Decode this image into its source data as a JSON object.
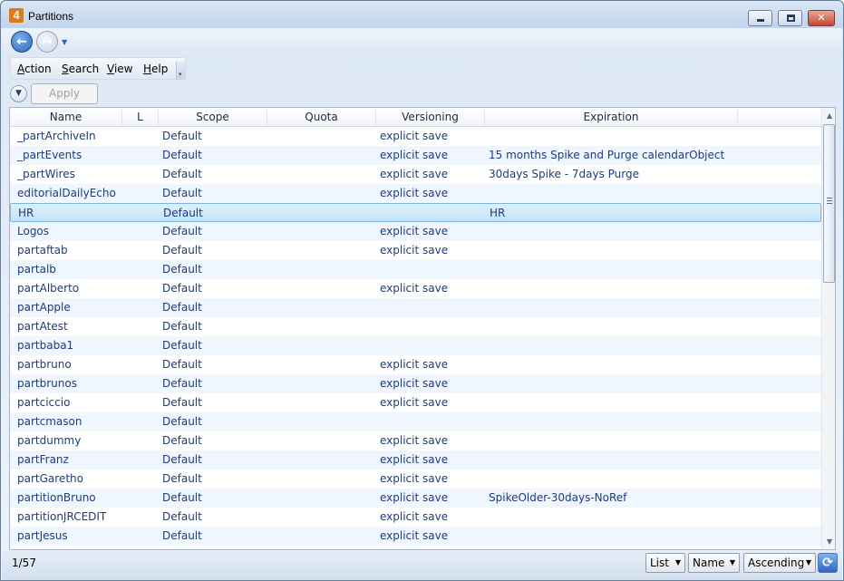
{
  "window": {
    "title": "Partitions",
    "app_icon": "4"
  },
  "nav": {
    "back_icon": "back-arrow-icon",
    "forward_icon": "forward-arrow-icon"
  },
  "menu": {
    "items": [
      {
        "label": "Action",
        "icon": ""
      },
      {
        "label": "Search",
        "icon": ""
      },
      {
        "label": "View",
        "icon": ""
      },
      {
        "label": "Help",
        "icon": ""
      }
    ]
  },
  "search": {
    "apply_label": "Apply Search"
  },
  "table": {
    "columns": [
      "Name",
      "L",
      "Scope",
      "Quota",
      "Versioning",
      "Expiration"
    ],
    "rows": [
      {
        "name": "_partArchiveIn",
        "scope": "Default",
        "versioning": "explicit save",
        "expiration": ""
      },
      {
        "name": "_partEvents",
        "scope": "Default",
        "versioning": "explicit save",
        "expiration": "15 months Spike and Purge calendarObject"
      },
      {
        "name": "_partWires",
        "scope": "Default",
        "versioning": "explicit save",
        "expiration": "30days Spike - 7days Purge"
      },
      {
        "name": "editorialDailyEcho",
        "scope": "Default",
        "versioning": "explicit save",
        "expiration": ""
      },
      {
        "name": "HR",
        "scope": "Default",
        "versioning": "",
        "expiration": "HR"
      },
      {
        "name": "Logos",
        "scope": "Default",
        "versioning": "explicit save",
        "expiration": ""
      },
      {
        "name": "partaftab",
        "scope": "Default",
        "versioning": "explicit save",
        "expiration": ""
      },
      {
        "name": "partalb",
        "scope": "Default",
        "versioning": "",
        "expiration": ""
      },
      {
        "name": "partAlberto",
        "scope": "Default",
        "versioning": "explicit save",
        "expiration": ""
      },
      {
        "name": "partApple",
        "scope": "Default",
        "versioning": "",
        "expiration": ""
      },
      {
        "name": "partAtest",
        "scope": "Default",
        "versioning": "",
        "expiration": ""
      },
      {
        "name": "partbaba1",
        "scope": "Default",
        "versioning": "",
        "expiration": ""
      },
      {
        "name": "partbruno",
        "scope": "Default",
        "versioning": "explicit save",
        "expiration": ""
      },
      {
        "name": "partbrunos",
        "scope": "Default",
        "versioning": "explicit save",
        "expiration": ""
      },
      {
        "name": "partciccio",
        "scope": "Default",
        "versioning": "explicit save",
        "expiration": ""
      },
      {
        "name": "partcmason",
        "scope": "Default",
        "versioning": "",
        "expiration": ""
      },
      {
        "name": "partdummy",
        "scope": "Default",
        "versioning": "explicit save",
        "expiration": ""
      },
      {
        "name": "partFranz",
        "scope": "Default",
        "versioning": "explicit save",
        "expiration": ""
      },
      {
        "name": "partGaretho",
        "scope": "Default",
        "versioning": "explicit save",
        "expiration": ""
      },
      {
        "name": "partitionBruno",
        "scope": "Default",
        "versioning": "explicit save",
        "expiration": "SpikeOlder-30days-NoRef"
      },
      {
        "name": "partitionJRCEDIT",
        "scope": "Default",
        "versioning": "explicit save",
        "expiration": ""
      },
      {
        "name": "partJesus",
        "scope": "Default",
        "versioning": "explicit save",
        "expiration": ""
      }
    ],
    "selected_row": "HR"
  },
  "status": {
    "count": "1/57",
    "view_mode": "List",
    "sort_field": "Name",
    "sort_order": "Ascending",
    "refresh_icon": "refresh-icon"
  },
  "colors": {
    "selection": "#c4e3f8",
    "row_text": "#1f3b78",
    "alt_row": "#f0f6fd"
  }
}
